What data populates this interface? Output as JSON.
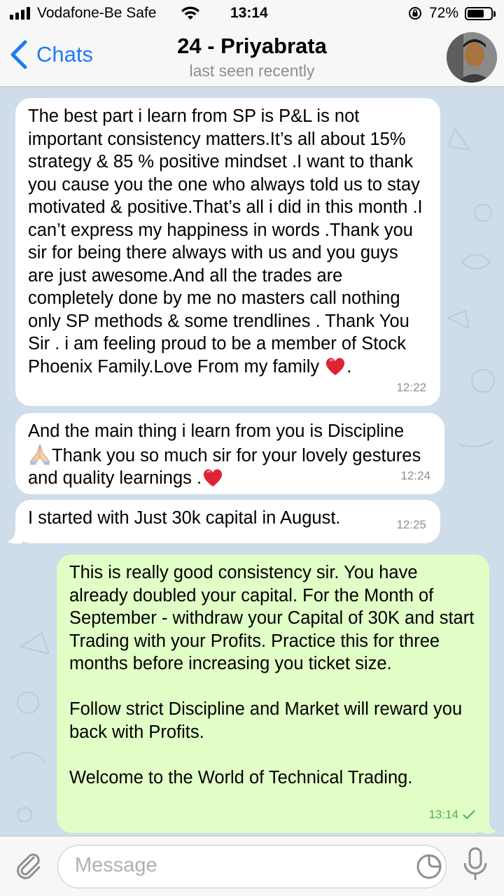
{
  "status_bar": {
    "carrier": "Vodafone-Be Safe",
    "time": "13:14",
    "battery_percent": "72%",
    "battery_level": 0.72
  },
  "header": {
    "back_label": "Chats",
    "title": "24 - Priyabrata",
    "subtitle": "last seen recently"
  },
  "messages": [
    {
      "direction": "incoming",
      "text": "The best part i learn from SP is P&L is not important consistency matters.It’s all about 15% strategy & 85 % positive mindset .I want to thank you cause you the one who always told us to stay motivated & positive.That’s all i did in this month .I can’t express my happiness in words .Thank you sir for being there always with us and you guys are just awesome.And all the trades are completely done by me no masters call nothing only SP methods & some trendlines . Thank You Sir . i am feeling proud to be a member of Stock Phoenix Family.Love From my family",
      "emoji_after": "heart",
      "text_tail": ".",
      "time": "12:22"
    },
    {
      "direction": "incoming",
      "text": "And the main thing i learn from you is Discipline",
      "emoji_mid": "folded-hands",
      "text_after": "Thank you so much sir for your lovely gestures and quality learnings .",
      "emoji_after": "heart",
      "time": "12:24"
    },
    {
      "direction": "incoming",
      "text": "I started with Just 30k capital in August.",
      "time": "12:25"
    },
    {
      "direction": "outgoing",
      "text": "This is really good consistency sir. You have already doubled your capital. For the Month of September - withdraw your Capital of 30K and start Trading with your Profits. Practice this for three months before increasing you ticket size.\n\nFollow strict Discipline and Market will reward you back with Profits.\n\nWelcome to the World of Technical Trading.",
      "time": "13:14",
      "status": "sent-check"
    }
  ],
  "input": {
    "placeholder": "Message"
  },
  "colors": {
    "accent": "#1a7cf5",
    "incoming_bubble": "#ffffff",
    "outgoing_bubble": "#e1fec6",
    "chat_background": "#cfdce9",
    "sent_check": "#4fae4e"
  }
}
